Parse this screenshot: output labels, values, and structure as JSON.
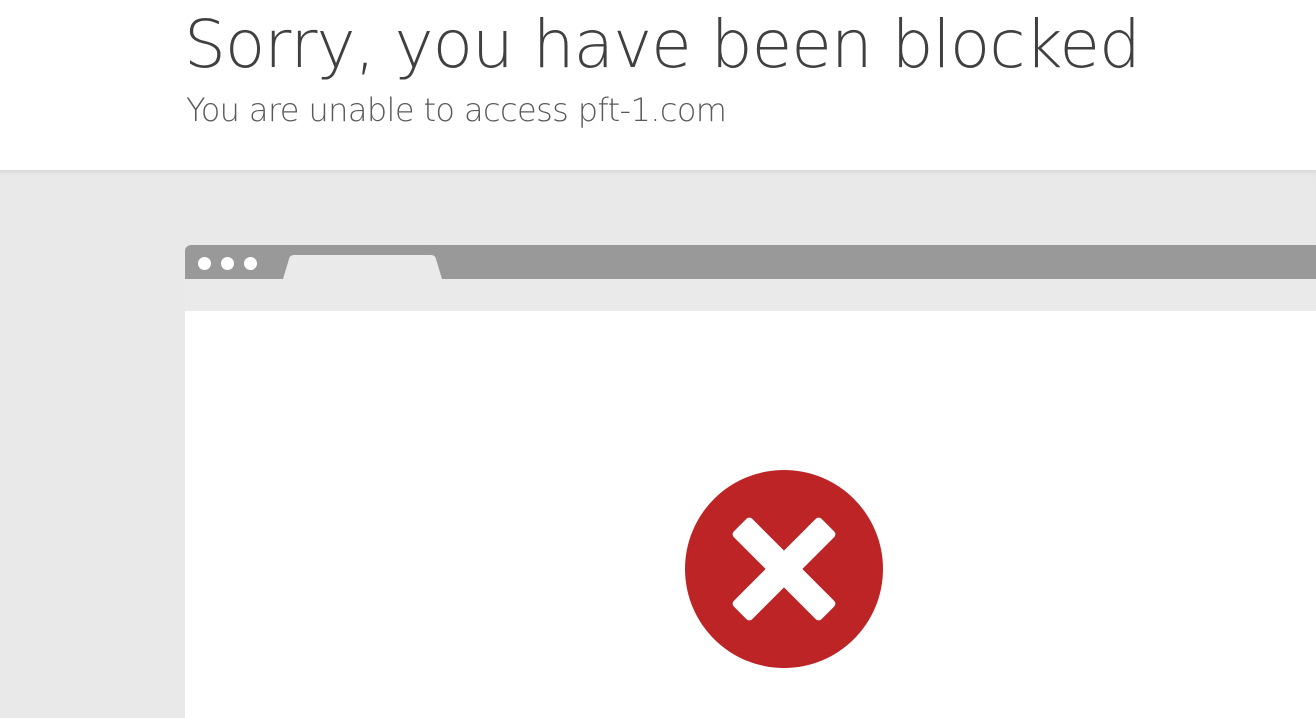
{
  "header": {
    "title": "Sorry, you have been blocked",
    "subtitle": "You are unable to access pft-1.com"
  },
  "browser_illustration": {
    "window_dots": [
      "dot",
      "dot",
      "dot"
    ],
    "icon": "error-x-icon"
  },
  "colors": {
    "title_text": "#404040",
    "subtitle_text": "#595959",
    "background_band": "#e9e9e9",
    "browser_bar": "#999999",
    "error_red": "#bd2426"
  }
}
